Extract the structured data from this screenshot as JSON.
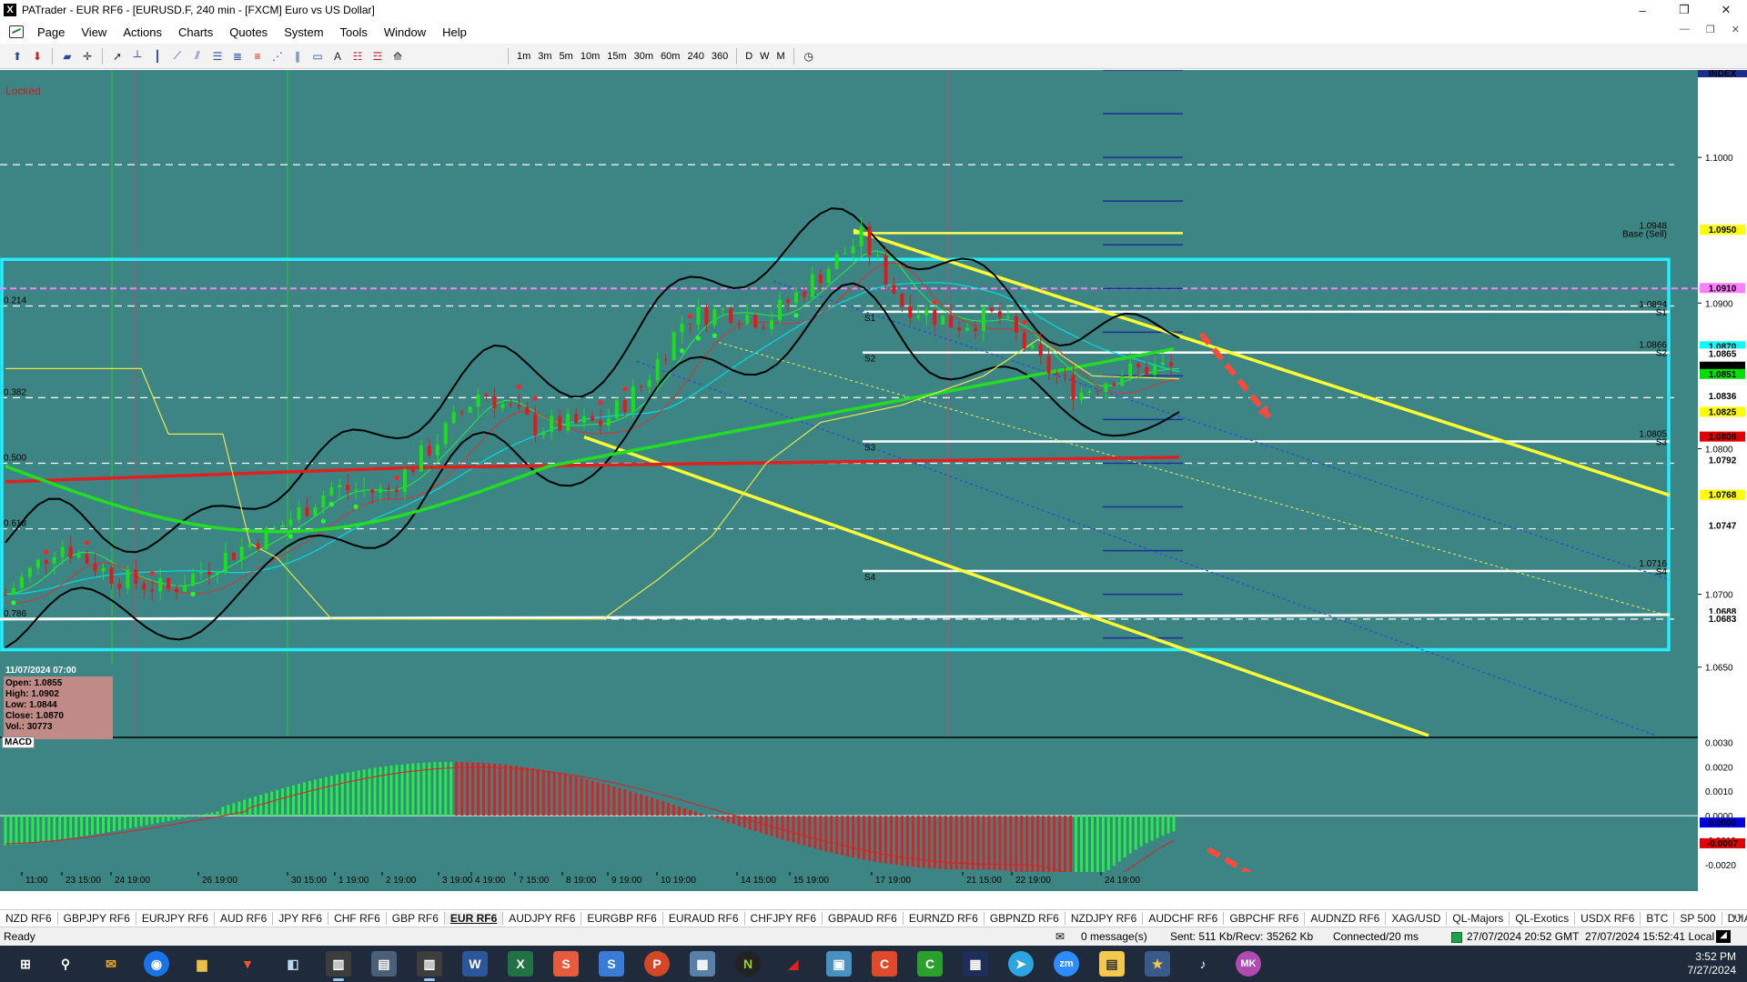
{
  "window": {
    "title": "PATrader - EUR RF6 - [EURUSD.F, 240 min - [FXCM] Euro vs US Dollar]",
    "minimize": "–",
    "maximize": "❐",
    "close": "✕"
  },
  "menu": {
    "items": [
      "Page",
      "View",
      "Actions",
      "Charts",
      "Quotes",
      "System",
      "Tools",
      "Window",
      "Help"
    ]
  },
  "toolbar": {
    "timeframes": [
      "1m",
      "3m",
      "5m",
      "10m",
      "15m",
      "30m",
      "60m",
      "240",
      "360",
      "D",
      "W",
      "M"
    ]
  },
  "chart": {
    "locked_label": "Locked",
    "index_label": "INDEX",
    "price_axis": [
      {
        "label": "1.1000",
        "value": 1.1
      },
      {
        "label": "1.0900",
        "value": 1.09
      },
      {
        "label": "1.0800",
        "value": 1.08
      },
      {
        "label": "1.0700",
        "value": 1.07
      },
      {
        "label": "1.0650",
        "value": 1.065
      }
    ],
    "price_markers": [
      {
        "label": "1.0950",
        "value": 1.095,
        "bg": "#ffff00"
      },
      {
        "label": "1.0910",
        "value": 1.091,
        "bg": "#ff80ff"
      },
      {
        "label": "1.0870",
        "value": 1.087,
        "bg": "#00ffff"
      },
      {
        "label": "1.0865",
        "value": 1.0865,
        "bg": "#ffffff"
      },
      {
        "label": "1.0856",
        "value": 1.0856,
        "bg": "#000000",
        "fg": "#ffffff"
      },
      {
        "label": "1.0851",
        "value": 1.0851,
        "bg": "#00e000"
      },
      {
        "label": "1.0836",
        "value": 1.0836,
        "bg": "#ffffff"
      },
      {
        "label": "1.0825",
        "value": 1.0825,
        "bg": "#ffff00"
      },
      {
        "label": "1.0808",
        "value": 1.0808,
        "bg": "#e00000",
        "fg": "#ffffff"
      },
      {
        "label": "1.0792",
        "value": 1.0792,
        "bg": "#ffffff"
      },
      {
        "label": "1.0768",
        "value": 1.0768,
        "bg": "#ffff00"
      },
      {
        "label": "1.0747",
        "value": 1.0747,
        "bg": "#ffffff"
      },
      {
        "label": "1.0688",
        "value": 1.0688,
        "bg": "#ffffff"
      },
      {
        "label": "1.0683",
        "value": 1.0683,
        "bg": "#ffffff"
      }
    ],
    "fib_labels": [
      {
        "label": "0.214",
        "value": 1.0898
      },
      {
        "label": "0.382",
        "value": 1.0835
      },
      {
        "label": "0.500",
        "value": 1.079
      },
      {
        "label": "0.618",
        "value": 1.0745
      },
      {
        "label": "0.786",
        "value": 1.0683
      }
    ],
    "pivot_labels": [
      {
        "label": "1.0948",
        "sub": "Base (Sell)",
        "value": 1.0948
      },
      {
        "label": "1.0894",
        "sub": "S1",
        "value": 1.0894
      },
      {
        "label": "1.0866",
        "sub": "S2",
        "value": 1.0866
      },
      {
        "label": "1.0805",
        "sub": "S3",
        "value": 1.0805
      },
      {
        "label": "1.0716",
        "sub": "S4",
        "value": 1.0716
      }
    ],
    "pivot_short": [
      "S1",
      "S2",
      "S3",
      "S4"
    ],
    "ohlc": {
      "date": "11/07/2024 07:00",
      "open": "Open: 1.0855",
      "high": "High: 1.0902",
      "low": "Low: 1.0844",
      "close": "Close: 1.0870",
      "vol": "Vol.: 30773"
    },
    "macd_label": "MACD",
    "macd_axis": [
      "0.0030",
      "0.0020",
      "0.0010",
      "0.0000",
      "-0.0010",
      "-0.0020"
    ],
    "macd_markers": [
      {
        "label": "0.0000",
        "bg": "#0000e0",
        "fg": "#ffffff"
      },
      {
        "label": "-0.0007",
        "bg": "#e00000",
        "fg": "#ffffff"
      }
    ],
    "time_axis": [
      "11:00",
      "23 15:00",
      "24 19:00",
      "26 19:00",
      "30 15:00",
      "1 19:00",
      "2 19:00",
      "3 19:00",
      "4 19:00",
      "7 15:00",
      "8 19:00",
      "9 19:00",
      "10 19:00",
      "14 15:00",
      "15 19:00",
      "17 19:00",
      "21 15:00",
      "22 19:00",
      "24 19:00"
    ]
  },
  "tabs": [
    "NZD RF6",
    "GBPJPY RF6",
    "EURJPY RF6",
    "AUD RF6",
    "JPY RF6",
    "CHF RF6",
    "GBP RF6",
    "EUR RF6",
    "AUDJPY RF6",
    "EURGBP RF6",
    "EURAUD RF6",
    "CHFJPY RF6",
    "GBPAUD RF6",
    "EURNZD RF6",
    "GBPNZD RF6",
    "NZDJPY RF6",
    "AUDCHF RF6",
    "GBPCHF RF6",
    "AUDNZD RF6",
    "XAG/USD",
    "QL-Majors",
    "QL-Exotics",
    "USDX RF6",
    "BTC",
    "SP 500",
    "DJIA"
  ],
  "active_tab": "EUR RF6",
  "status": {
    "ready": "Ready",
    "messages": "0 message(s)",
    "traffic": "Sent: 511 Kb/Recv: 35262 Kb",
    "connected": "Connected/20 ms",
    "server_time": "27/07/2024 20:52 GMT",
    "local_time": "27/07/2024 15:52:41 Local"
  },
  "taskbar": {
    "time": "3:52 PM",
    "date": "7/27/2024",
    "apps": [
      "W",
      "X",
      "S",
      "S",
      "P",
      "C",
      "C",
      "zm",
      "MK"
    ]
  },
  "colors": {
    "chart_bg": "#3d8585",
    "bull": "#19e019",
    "bear": "#e01919",
    "channel": "#ffff33",
    "box": "#22eeff"
  }
}
